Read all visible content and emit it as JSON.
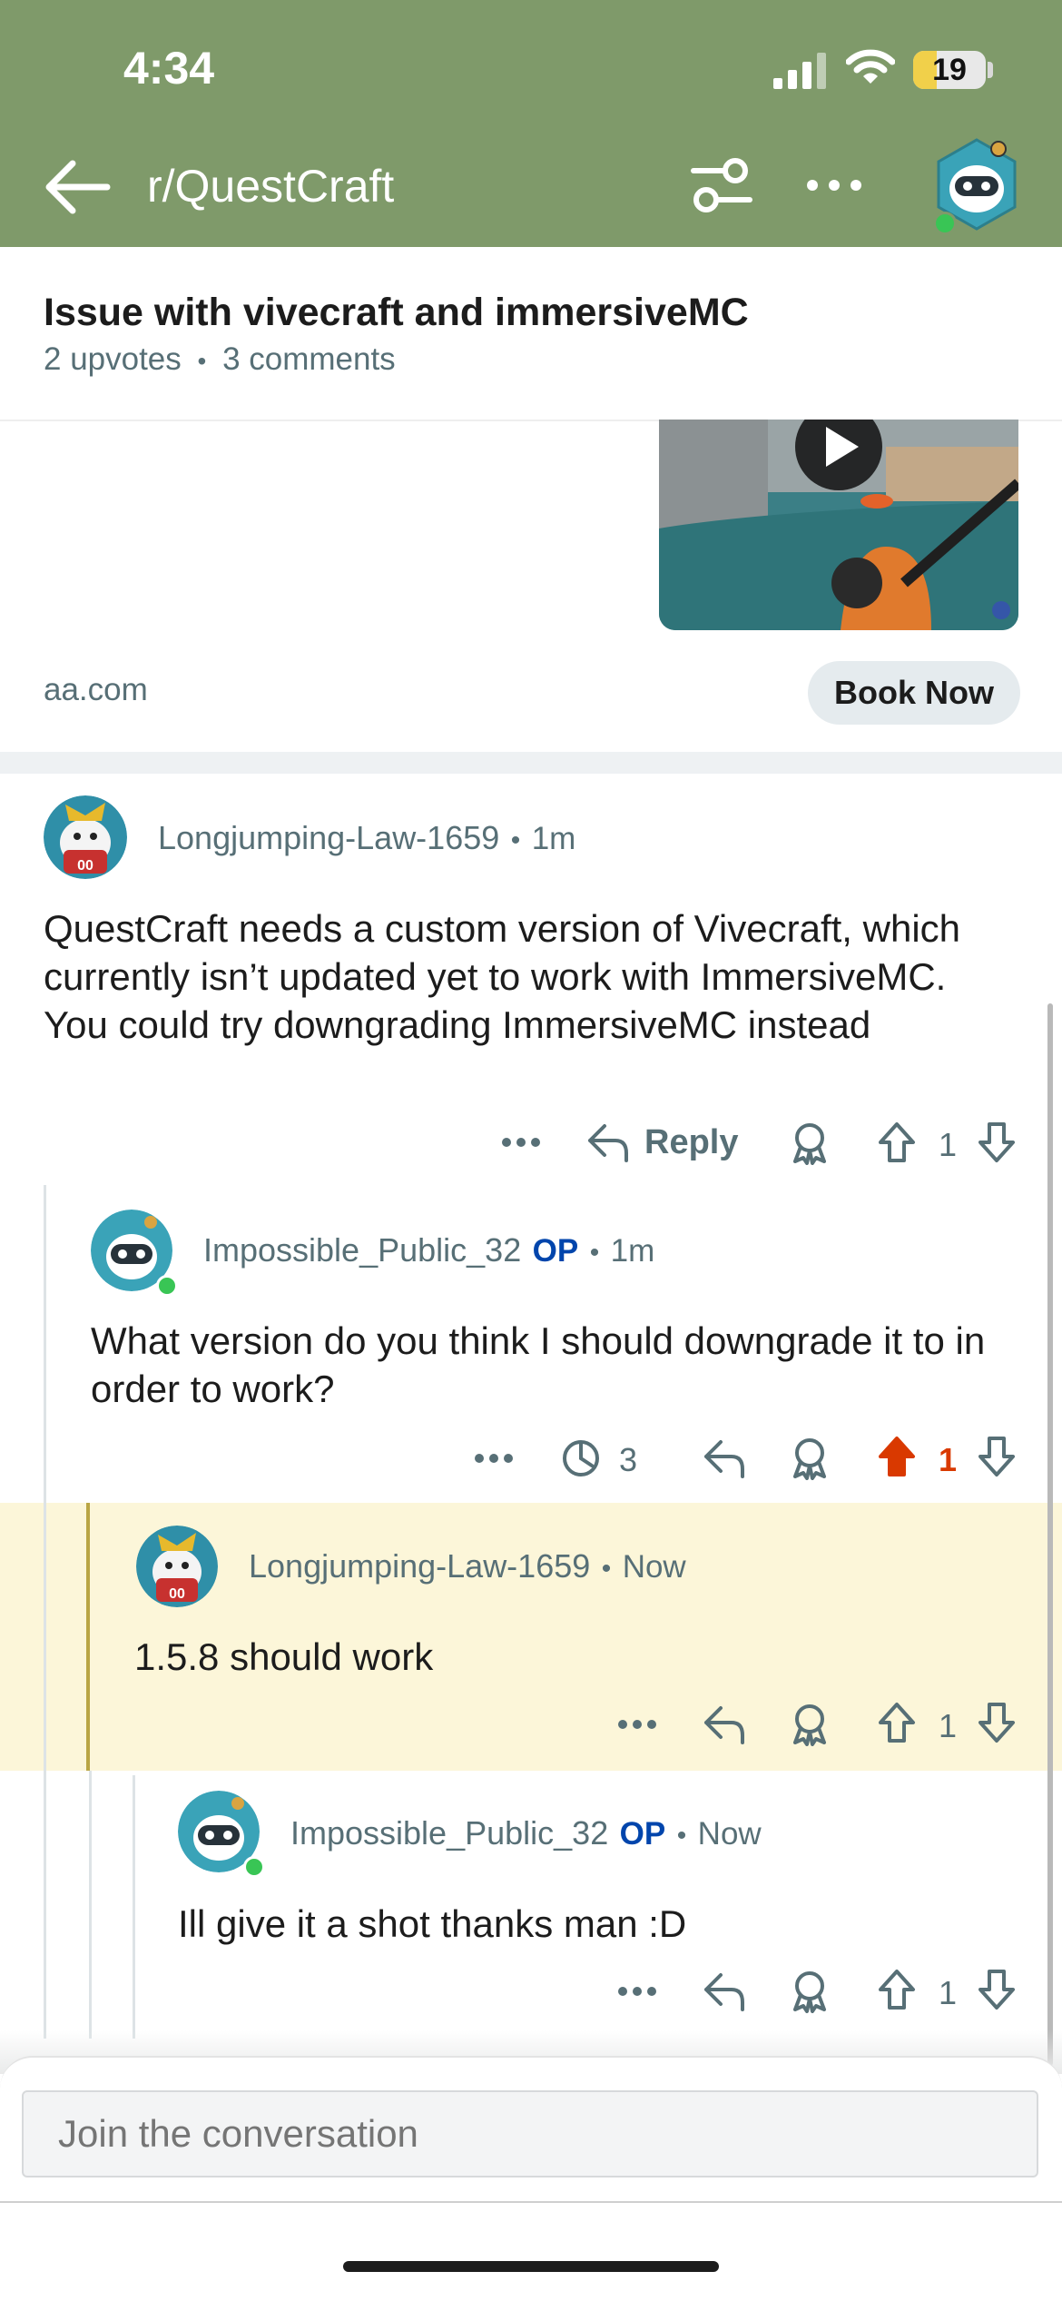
{
  "status_bar": {
    "time": "4:34",
    "battery": "19"
  },
  "header": {
    "subreddit": "r/QuestCraft"
  },
  "post": {
    "title": "Issue with vivecraft and immersiveMC",
    "upvotes": "2 upvotes",
    "meta_sep": "•",
    "comments": "3 comments"
  },
  "ad": {
    "domain": "aa.com",
    "cta": "Book Now"
  },
  "comments": [
    {
      "author": "Longjumping-Law-1659",
      "op": "",
      "sep": "•",
      "time": "1m",
      "body": "QuestCraft needs a custom version of Vivecraft, which currently isn’t updated yet to work with ImmersiveMC. You could try downgrading ImmersiveMC instead",
      "reply_label": "Reply",
      "score": "1",
      "upvoted": false
    },
    {
      "author": "Impossible_Public_32",
      "op": "OP",
      "sep": "•",
      "time": "1m",
      "body": "What version do you think I should downgrade it to in order to work?",
      "timer_count": "3",
      "score": "1",
      "upvoted": true
    },
    {
      "author": "Longjumping-Law-1659",
      "op": "",
      "sep": "•",
      "time": "Now",
      "body": "1.5.8 should work",
      "score": "1",
      "upvoted": false
    },
    {
      "author": "Impossible_Public_32",
      "op": "OP",
      "sep": "•",
      "time": "Now",
      "body": "Ill give it a shot thanks man :D",
      "score": "1",
      "upvoted": false
    }
  ],
  "composer": {
    "placeholder": "Join the conversation"
  },
  "colors": {
    "header_bg": "#7f9a6a",
    "upvote_active": "#d93900",
    "op_blue": "#0045ac",
    "highlight_bg": "#fcf6d9"
  },
  "icons": [
    "back-arrow-icon",
    "filter-icon",
    "more-icon",
    "reply-icon",
    "award-icon",
    "upvote-icon",
    "downvote-icon",
    "timer-icon"
  ]
}
